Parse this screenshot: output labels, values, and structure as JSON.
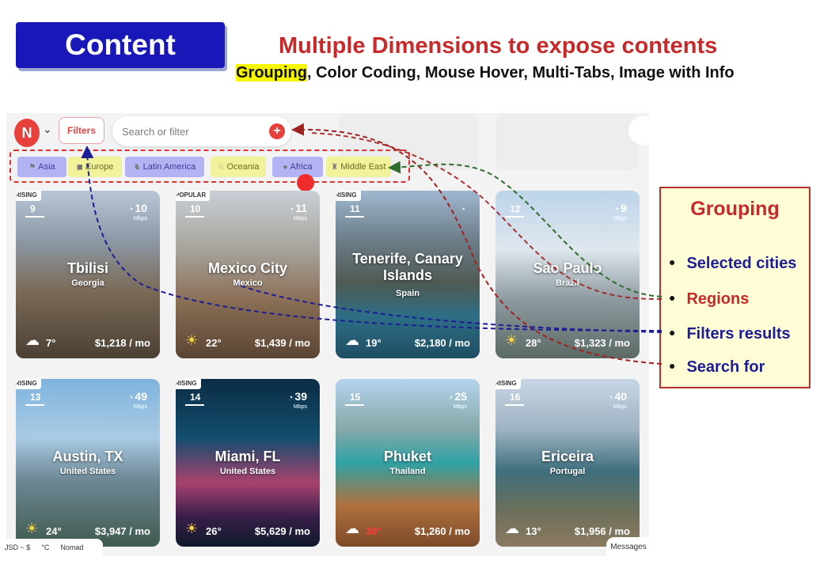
{
  "slide": {
    "badge": "Content",
    "title": "Multiple Dimensions to expose contents",
    "subtitle_highlight": "Grouping",
    "subtitle_rest": ", Color Coding, Mouse Hover, Multi-Tabs, Image with Info"
  },
  "app": {
    "filters_label": "Filters",
    "search_placeholder": "Search or filter",
    "plus": "+",
    "regions": [
      "Asia",
      "Europe",
      "Latin America",
      "Oceania",
      "Africa",
      "Middle East"
    ],
    "cards": [
      {
        "badge": "RISING",
        "rank": "9",
        "wifi": "10",
        "wifi_unit": "Mbps",
        "city": "Tbilisi",
        "country": "Georgia",
        "temp": "7°",
        "price": "$1,218 / mo"
      },
      {
        "badge": "POPULAR",
        "rank": "10",
        "wifi": "11",
        "wifi_unit": "Mbps",
        "city": "Mexico City",
        "country": "Mexico",
        "temp": "22°",
        "price": "$1,439 / mo"
      },
      {
        "badge": "RISING",
        "rank": "11",
        "wifi": "",
        "wifi_unit": "",
        "city": "Tenerife, Canary Islands",
        "country": "Spain",
        "temp": "19°",
        "price": "$2,180 / mo"
      },
      {
        "badge": "",
        "rank": "12",
        "wifi": "9",
        "wifi_unit": "Mbps",
        "city": "Sao Paulo",
        "country": "Brazil",
        "temp": "28°",
        "price": "$1,323 / mo"
      },
      {
        "badge": "RISING",
        "rank": "13",
        "wifi": "49",
        "wifi_unit": "Mbps",
        "city": "Austin, TX",
        "country": "United States",
        "temp": "24°",
        "price": "$3,947 / mo"
      },
      {
        "badge": "RISING",
        "rank": "14",
        "wifi": "39",
        "wifi_unit": "Mbps",
        "city": "Miami, FL",
        "country": "United States",
        "temp": "26°",
        "price": "$5,629 / mo"
      },
      {
        "badge": "",
        "rank": "15",
        "wifi": "25",
        "wifi_unit": "Mbps",
        "city": "Phuket",
        "country": "Thailand",
        "temp": "30°",
        "price": "$1,260 / mo"
      },
      {
        "badge": "RISING",
        "rank": "16",
        "wifi": "40",
        "wifi_unit": "Mbps",
        "city": "Ericeira",
        "country": "Portugal",
        "temp": "13°",
        "price": "$1,956 / mo"
      }
    ],
    "bottom": {
      "currency": "JSD ~ $",
      "unit": "°C",
      "mode": "Nomad",
      "messages": "Messages"
    }
  },
  "grouping": {
    "title": "Grouping",
    "items": [
      "Selected cities",
      "Regions",
      "Filters results",
      "Search for"
    ]
  },
  "colors": {
    "accent": "#e8413b",
    "badge_blue": "#1a17b8",
    "title_red": "#c62a2a",
    "item_blue": "#1d1d96"
  }
}
